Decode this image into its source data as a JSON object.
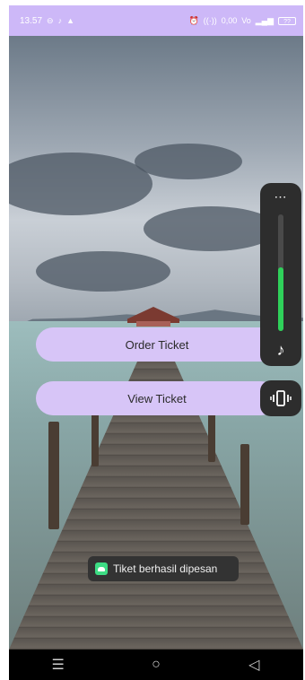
{
  "status_bar": {
    "time": "13.57",
    "left_icons": [
      "notification-circle-icon",
      "tiktok-icon",
      "warning-icon"
    ],
    "right_icons": [
      "alarm-icon",
      "hotspot-icon",
      "network-speed-icon",
      "volte-icon",
      "signal-icon"
    ],
    "speed_text": "0,00",
    "battery_level": "??"
  },
  "main": {
    "order_button_label": "Order Ticket",
    "view_button_label": "View Ticket"
  },
  "volume_panel": {
    "more_label": "⋯",
    "level_fraction": 0.55,
    "accent_color": "#2fd15a",
    "note_icon": "♪"
  },
  "vibrate_icon": "▯",
  "toast": {
    "message": "Tiket berhasil dipesan"
  },
  "nav": {
    "menu_glyph": "☰",
    "home_glyph": "○",
    "back_glyph": "◁"
  },
  "colors": {
    "status_bar": "#cdb8f8",
    "button": "#d7c5f7"
  }
}
